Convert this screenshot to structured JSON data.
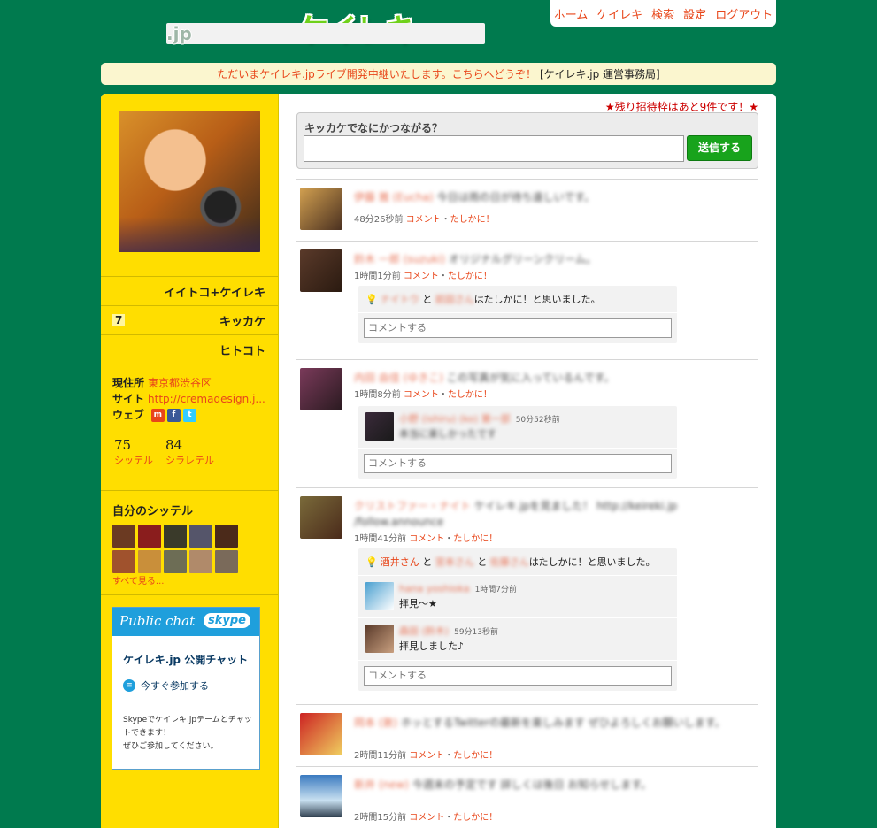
{
  "logo": {
    "main": "ケイレキ",
    "sub": ".jp"
  },
  "topnav": [
    "ホーム",
    "ケイレキ",
    "検索",
    "設定",
    "ログアウト"
  ],
  "notice": {
    "link": "ただいまケイレキ.jpライブ開発中継いたします。こちらへどうぞ！",
    "suffix": "[ケイレキ.jp 運営事務局]"
  },
  "sidebar": {
    "menu": [
      {
        "label": "イイトコ+ケイレキ"
      },
      {
        "label": "キッカケ",
        "count": "7"
      },
      {
        "label": "ヒトコト"
      }
    ],
    "profile": {
      "location_label": "現住所",
      "location": "東京都渋谷区",
      "site_label": "サイト",
      "site": "http://cremadesign.j...",
      "web_label": "ウェブ"
    },
    "stats": [
      {
        "n": "75",
        "l": "シッテル"
      },
      {
        "n": "84",
        "l": "シラレテル"
      }
    ],
    "mine_title": "自分のシッテル",
    "seeall": "すべて見る...",
    "skype": {
      "public_chat": "Public chat",
      "brand": "skype",
      "title": "ケイレキ.jp 公開チャット",
      "join": "今すぐ参加する",
      "desc1": "Skypeでケイレキ.jpテームとチャットできます！",
      "desc2": "ぜひご参加してください。"
    }
  },
  "main": {
    "invite": "★残り招待枠はあと9件です！★",
    "question": "キッカケでなにかつながる？",
    "send": "送信する",
    "comment_placeholder": "コメントする",
    "comment_link": "コメント",
    "sep": "・",
    "like_link": "たしかに！",
    "posts": [
      {
        "time": "48分26秒前",
        "name": "伊藤 雅 (Eucha)",
        "text": "今日は雨の日が待ち遠しいです。"
      },
      {
        "time": "1時間1分前",
        "name": "鈴木 一郎 (suzuki)",
        "text": "オリジナルグリーンクリーム。",
        "likes_a": "ナイトウ",
        "likes_b": "前田さん",
        "likes_tail": "はたしかに！と思いました。"
      },
      {
        "time": "1時間8分前",
        "name": "内田 由佳 (ゆきこ)",
        "text": "この写真が気に入っているんです。",
        "reply_name": "小野 (ishiru) (ko)",
        "reply_name2": "第一部",
        "reply_time": "50分52秒前",
        "reply_text": "本当に楽しかったです"
      },
      {
        "time": "1時間41分前",
        "name": "クリストファー・ナイト",
        "text": "ケイレキ.jpを見ました！ http://keireki.jp /follow.announce",
        "likes_a": "酒井さん",
        "likes_b": "宮本さん",
        "likes_c": "佐藤さん",
        "likes_tail": "はたしかに！と思いました。",
        "r1_name": "hana yoshioka",
        "r1_time": "1時間7分前",
        "r1_text": "拝見〜★",
        "r2_name": "森田 (鈴木)",
        "r2_time": "59分13秒前",
        "r2_text": "拝見しました♪"
      },
      {
        "time": "2時間11分前",
        "name": "岡本 (敦)",
        "text": "ホッとするTwitterの最新を楽しみます ぜひよろしくお願いします。"
      },
      {
        "time": "2時間15分前",
        "name": "新井 (new)",
        "text": "今週末の予定です 詳しくは後日 お知らせします。"
      }
    ]
  },
  "colors": {
    "bg": "#007a4e",
    "sidebar": "#ffde00",
    "accent": "#e8461a",
    "send": "#18a31c"
  }
}
